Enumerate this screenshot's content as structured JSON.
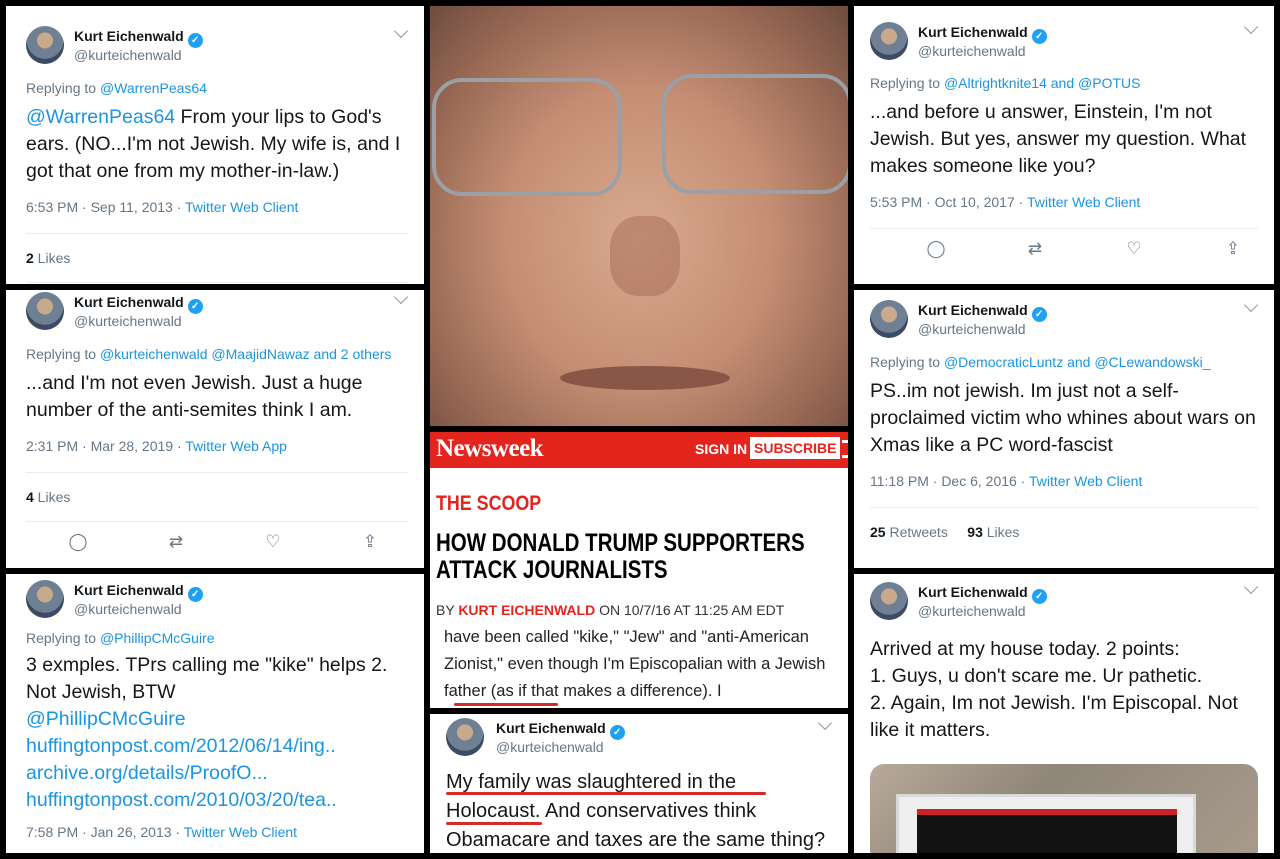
{
  "author": {
    "name": "Kurt Eichenwald",
    "handle": "@kurteichenwald"
  },
  "tweets": {
    "t1": {
      "reply_label": "Replying to",
      "reply_to": "@WarrenPeas64",
      "mention": "@WarrenPeas64",
      "text": " From your lips to God's ears. (NO...I'm not Jewish. My wife is, and I got that one from my mother-in-law.)",
      "time": "6:53 PM · Sep 11, 2013 · ",
      "client": "Twitter Web Client",
      "likes": "2",
      "likes_label": " Likes"
    },
    "t2": {
      "reply_label": "Replying to",
      "reply_to": "@kurteichenwald @MaajidNawaz and 2 others",
      "text": "...and I'm not even Jewish. Just a huge number of the anti-semites think I am.",
      "time": "2:31 PM · Mar 28, 2019 · ",
      "client": "Twitter Web App",
      "likes": "4",
      "likes_label": " Likes"
    },
    "t3": {
      "reply_label": "Replying to",
      "reply_to": "@PhillipCMcGuire",
      "text": "3 exmples. TPrs calling me \"kike\" helps 2. Not Jewish, BTW",
      "links": [
        "@PhillipCMcGuire",
        "huffingtonpost.com/2012/06/14/ing..",
        "archive.org/details/ProofO...",
        "huffingtonpost.com/2010/03/20/tea.."
      ],
      "time": "7:58 PM · Jan 26, 2013 · ",
      "client": "Twitter Web Client"
    },
    "t4": {
      "reply_label": "Replying to",
      "reply_to": "@Altrightknite14 and @POTUS",
      "text": "...and before u answer, Einstein, I'm not Jewish. But yes, answer my question. What makes someone like you?",
      "time": "5:53 PM · Oct 10, 2017 · ",
      "client": "Twitter Web Client"
    },
    "t5": {
      "reply_label": "Replying to",
      "reply_to": "@DemocraticLuntz and @CLewandowski_",
      "text": "PS..im not jewish. Im just not a self-proclaimed victim who whines about wars on Xmas like a PC word-fascist",
      "time": "11:18 PM · Dec 6, 2016 · ",
      "client": "Twitter Web Client",
      "retweets": "25",
      "retweets_label": " Retweets",
      "likes": "93",
      "likes_label": " Likes"
    },
    "t6": {
      "text_lines": [
        "Arrived at my house today. 2 points:",
        "1. Guys, u don't scare me. Ur pathetic.",
        "2. Again, Im not Jewish. I'm Episcopal. Not like it matters."
      ]
    },
    "t7": {
      "text": "My family was slaughtered in the Holocaust. And conservatives think Obamacare and taxes are the same thing?"
    }
  },
  "newsweek": {
    "logo": "Newsweek",
    "sign_in": "SIGN IN",
    "subscribe": "SUBSCRIBE",
    "section": "THE SCOOP",
    "headline": "HOW DONALD TRUMP SUPPORTERS ATTACK JOURNALISTS",
    "by": "BY ",
    "author": "KURT EICHENWALD",
    "date": " ON 10/7/16 AT 11:25 AM EDT",
    "excerpt": "have been called \"kike,\" \"Jew\" and \"anti-American Zionist,\" even though I'm Episcopalian with a Jewish father (as if that makes a difference). I"
  },
  "colors": {
    "twitter_blue": "#1da1f2",
    "link_blue": "#1b95e0",
    "newsweek_red": "#e4251e",
    "underline_red": "#d42a2a"
  }
}
